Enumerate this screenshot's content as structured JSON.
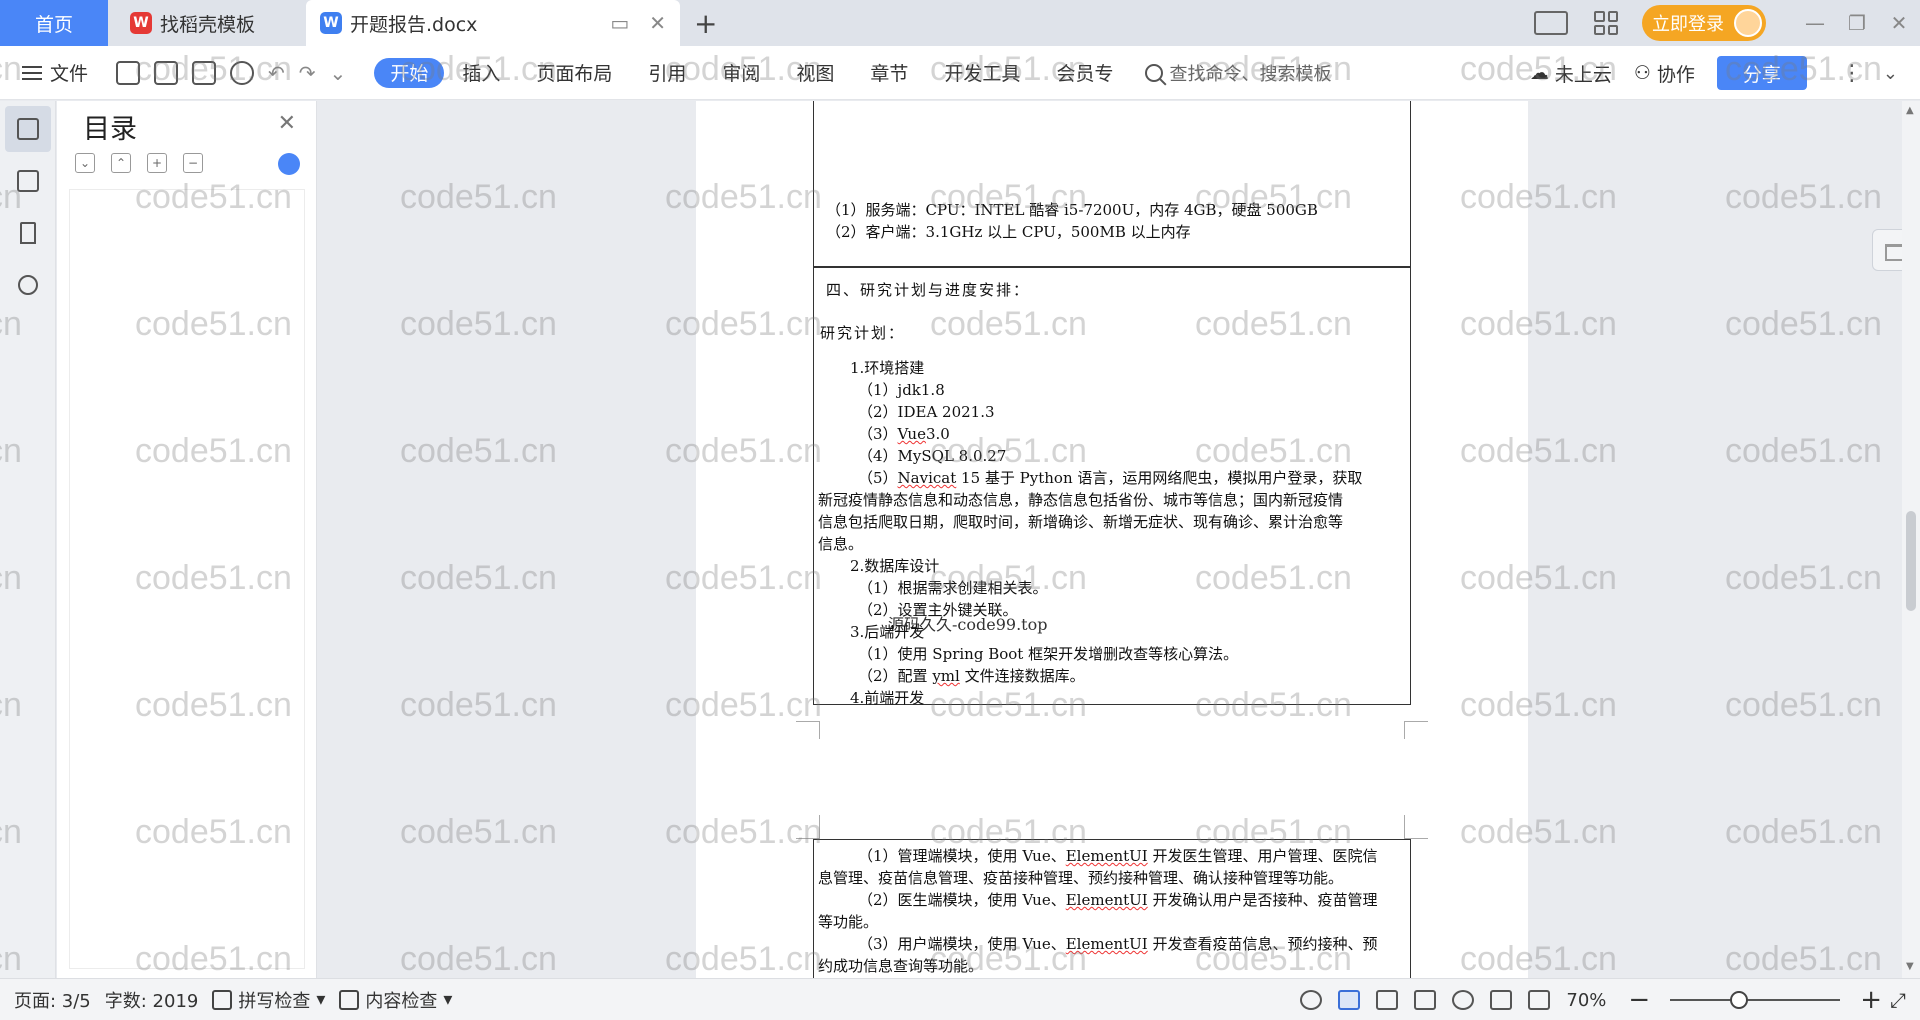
{
  "tabs": {
    "home": "首页",
    "template_tab": "找稻壳模板",
    "doc_tab": "开题报告.docx",
    "new_tab_symbol": "+",
    "login_button": "立即登录"
  },
  "ribbon": {
    "file_menu": "文件",
    "tabs": [
      "开始",
      "插入",
      "页面布局",
      "引用",
      "审阅",
      "视图",
      "章节",
      "开发工具",
      "会员专"
    ],
    "active_tab": "开始",
    "search_placeholder": "查找命令、搜索模板",
    "cloud_status": "未上云",
    "collab": "协作",
    "share": "分享"
  },
  "toc": {
    "title": "目录"
  },
  "document": {
    "page1_lines": [
      "（1）服务端：CPU：INTEL 酷睿 i5-7200U，内存 4GB，硬盘 500GB",
      "（2）客户端：3.1GHz 以上 CPU，500MB 以上内存",
      "四、研究计划与进度安排：",
      "研究计划：",
      "1.环境搭建",
      "（1）jdk1.8",
      "（2）IDEA 2021.3",
      "（3）Vue3.0",
      "（4）MySQL 8.0.27",
      "（5）Navicat 15 基于 Python 语言，运用网络爬虫，模拟用户登录，获取",
      "新冠疫情静态信息和动态信息，静态信息包括省份、城市等信息；国内新冠疫情",
      "信息包括爬取日期，爬取时间，新增确诊、新增无症状、现有确诊、累计治愈等",
      "信息。",
      "2.数据库设计",
      "（1）根据需求创建相关表。",
      "（2）设置主外键关联。",
      "3.后端开发",
      "（1）使用 Spring Boot 框架开发增删改查等核心算法。",
      "（2）配置 yml 文件连接数据库。",
      "4.前端开发"
    ],
    "doc_watermark": "源码久久-code99.top",
    "page2_lines": [
      "（1）管理端模块，使用 Vue、ElementUI 开发医生管理、用户管理、医院信",
      "息管理、疫苗信息管理、疫苗接种管理、预约接种管理、确认接种管理等功能。",
      "（2）医生端模块，使用 Vue、ElementUI 开发确认用户是否接种、疫苗管理",
      "等功能。",
      "（3）用户端模块，使用 Vue、ElementUI 开发查看疫苗信息、预约接种、预",
      "约成功信息查询等功能。"
    ]
  },
  "overlay_watermark": "code51.cn",
  "status": {
    "page": "页面: 3/5",
    "word_count": "字数: 2019",
    "spell_check": "拼写检查",
    "content_check": "内容检查",
    "zoom": "70%"
  },
  "colors": {
    "accent": "#4a86f7",
    "login": "#f5a623"
  }
}
